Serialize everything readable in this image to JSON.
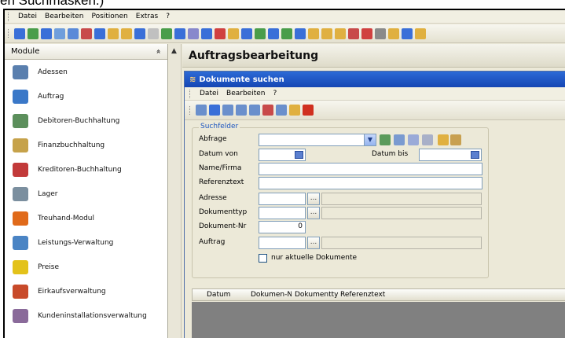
{
  "caption": "en Suchmasken.)",
  "menubar": {
    "items": [
      "Datei",
      "Bearbeiten",
      "Positionen",
      "Extras",
      "?"
    ]
  },
  "toolbar": {
    "colors": [
      "#3a6fd8",
      "#4a9d4a",
      "#3a6fd8",
      "#6f9edc",
      "#5a8ad8",
      "#c84a4a",
      "#3a6fd8",
      "#e0b040",
      "#e0b040",
      "#3a6fd8",
      "#c0c0c0",
      "#4a9d4a",
      "#3a6fd8",
      "#8888cc",
      "#3a6fd8",
      "#d04040",
      "#e0b040",
      "#3a6fd8",
      "#4a9d4a",
      "#3a6fd8",
      "#4a9d4a",
      "#3a6fd8",
      "#e0b040",
      "#e0b040",
      "#e0b040",
      "#c84a4a",
      "#d04040",
      "#8a8a8a",
      "#e0b040",
      "#3a6fd8",
      "#e0b040"
    ]
  },
  "sidebar": {
    "header": "Module",
    "collapse_glyph": "»",
    "items": [
      {
        "label": "Adessen",
        "color": "#5a7fae"
      },
      {
        "label": "Auftrag",
        "color": "#3a78c8"
      },
      {
        "label": "Debitoren-Buchhaltung",
        "color": "#5c8f5c"
      },
      {
        "label": "Finanzbuchhaltung",
        "color": "#c6a24a"
      },
      {
        "label": "Kreditoren-Buchhaltung",
        "color": "#c23a3a"
      },
      {
        "label": "Lager",
        "color": "#7b8f9f"
      },
      {
        "label": "Treuhand-Modul",
        "color": "#e06a1a"
      },
      {
        "label": "Leistungs-Verwaltung",
        "color": "#4a84c4"
      },
      {
        "label": "Preise",
        "color": "#e3c21a"
      },
      {
        "label": "Eirkaufsverwaltung",
        "color": "#c84a2a"
      },
      {
        "label": "Kundeninstallationsverwaltung",
        "color": "#8a6a9a"
      }
    ]
  },
  "main": {
    "title": "Auftragsbearbeitung"
  },
  "dialog": {
    "title": "Dokumente suchen",
    "menu": [
      "Datei",
      "Bearbeiten",
      "?"
    ],
    "toolbar_colors": [
      "#6a8fcc",
      "#3a6fd8",
      "#6a8fcc",
      "#6a8fcc",
      "#6a8fcc",
      "#c84a4a",
      "#6a8fcc",
      "#e0b040",
      "#d03020"
    ],
    "group_title": "Suchfelder",
    "fields": {
      "abfrage": "Abfrage",
      "datum_von": "Datum von",
      "datum_bis": "Datum bis",
      "name_firma": "Name/Firma",
      "referenztext": "Referenztext",
      "adresse": "Adresse",
      "dokumenttyp": "Dokumenttyp",
      "dokument_nr": "Dokument-Nr",
      "dokument_nr_value": "0",
      "auftrag": "Auftrag",
      "checkbox_label": "nur aktuelle Dokumente",
      "ellipsis": "..."
    },
    "table": {
      "columns": [
        "Datum",
        "Dokumen-N",
        "Dokumenttyp",
        "Referenztext"
      ]
    }
  }
}
